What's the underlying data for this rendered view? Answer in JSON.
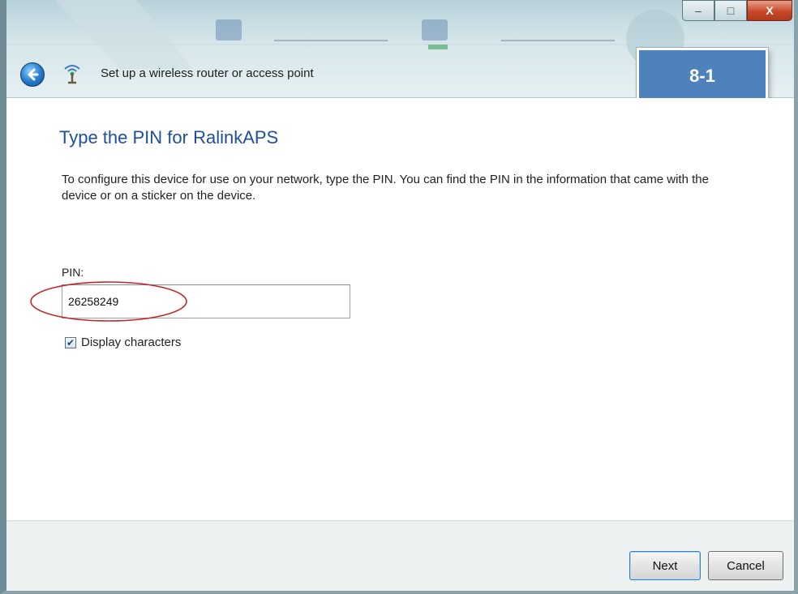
{
  "window": {
    "title": "Set up a wireless router or access point",
    "step_badge": "8-1",
    "controls": {
      "minimize_glyph": "–",
      "maximize_glyph": "□",
      "close_glyph": "X"
    }
  },
  "icons": {
    "back": "back-arrow-icon",
    "wizard": "wireless-network-icon",
    "check": "checkmark-icon"
  },
  "main": {
    "heading": "Type the PIN for RalinkAPS",
    "instructions": "To configure this device for use on your network, type the PIN. You can find the PIN in the information that came with the device or on a sticker on the device.",
    "pin_label": "PIN:",
    "pin_value": "26258249",
    "display_characters_label": "Display characters",
    "display_characters_checked": true
  },
  "footer": {
    "next_label": "Next",
    "cancel_label": "Cancel"
  },
  "colors": {
    "accent_blue": "#4f81bd",
    "heading_blue": "#1f4e9a",
    "highlight_red": "#c0272d",
    "close_red": "#c8482a"
  }
}
